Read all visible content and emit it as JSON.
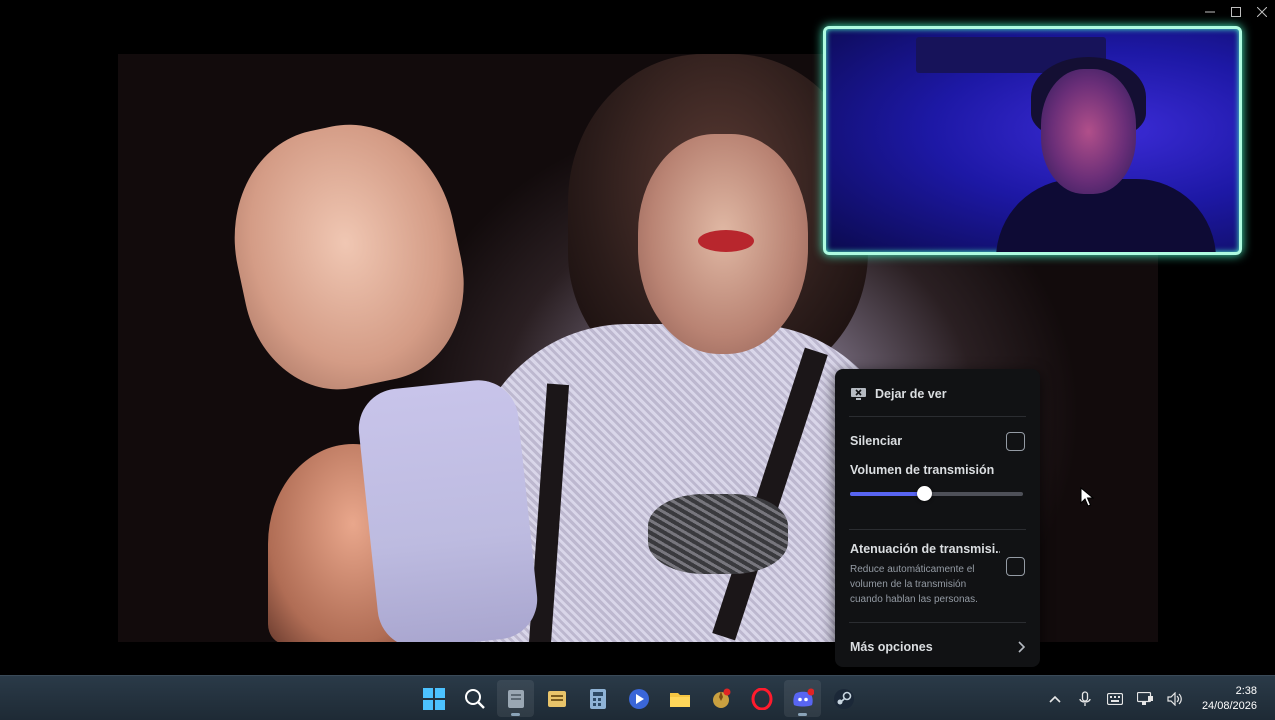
{
  "window": {
    "controls": {
      "minimize_icon": "minimize-icon",
      "maximize_icon": "maximize-icon",
      "close_icon": "close-icon"
    }
  },
  "stream_menu": {
    "stop_watching_label": "Dejar de ver",
    "mute_label": "Silenciar",
    "mute_checked": false,
    "volume_label": "Volumen de transmisión",
    "volume_percent": 42,
    "ducking_title": "Atenuación de transmisi...",
    "ducking_description": "Reduce automáticamente el volumen de la transmisión cuando hablan las personas.",
    "ducking_checked": false,
    "more_options_label": "Más opciones",
    "accent_color": "#5865f2"
  },
  "camera_overlay": {
    "border_color": "#48f4c5"
  },
  "taskbar": {
    "apps": [
      {
        "name": "windows-start",
        "icon": "windows-logo-icon"
      },
      {
        "name": "search",
        "icon": "search-icon"
      },
      {
        "name": "file-manager",
        "icon": "document-icon"
      },
      {
        "name": "notes",
        "icon": "notepad-icon"
      },
      {
        "name": "calculator",
        "icon": "calculator-icon"
      },
      {
        "name": "media-player",
        "icon": "play-icon"
      },
      {
        "name": "file-explorer",
        "icon": "folder-icon"
      },
      {
        "name": "game",
        "icon": "game-icon"
      },
      {
        "name": "opera",
        "icon": "opera-icon"
      },
      {
        "name": "discord",
        "icon": "discord-icon"
      },
      {
        "name": "steam",
        "icon": "steam-icon"
      }
    ],
    "tray": {
      "clock_time": "2:38",
      "clock_date": "24/08/2026"
    }
  }
}
